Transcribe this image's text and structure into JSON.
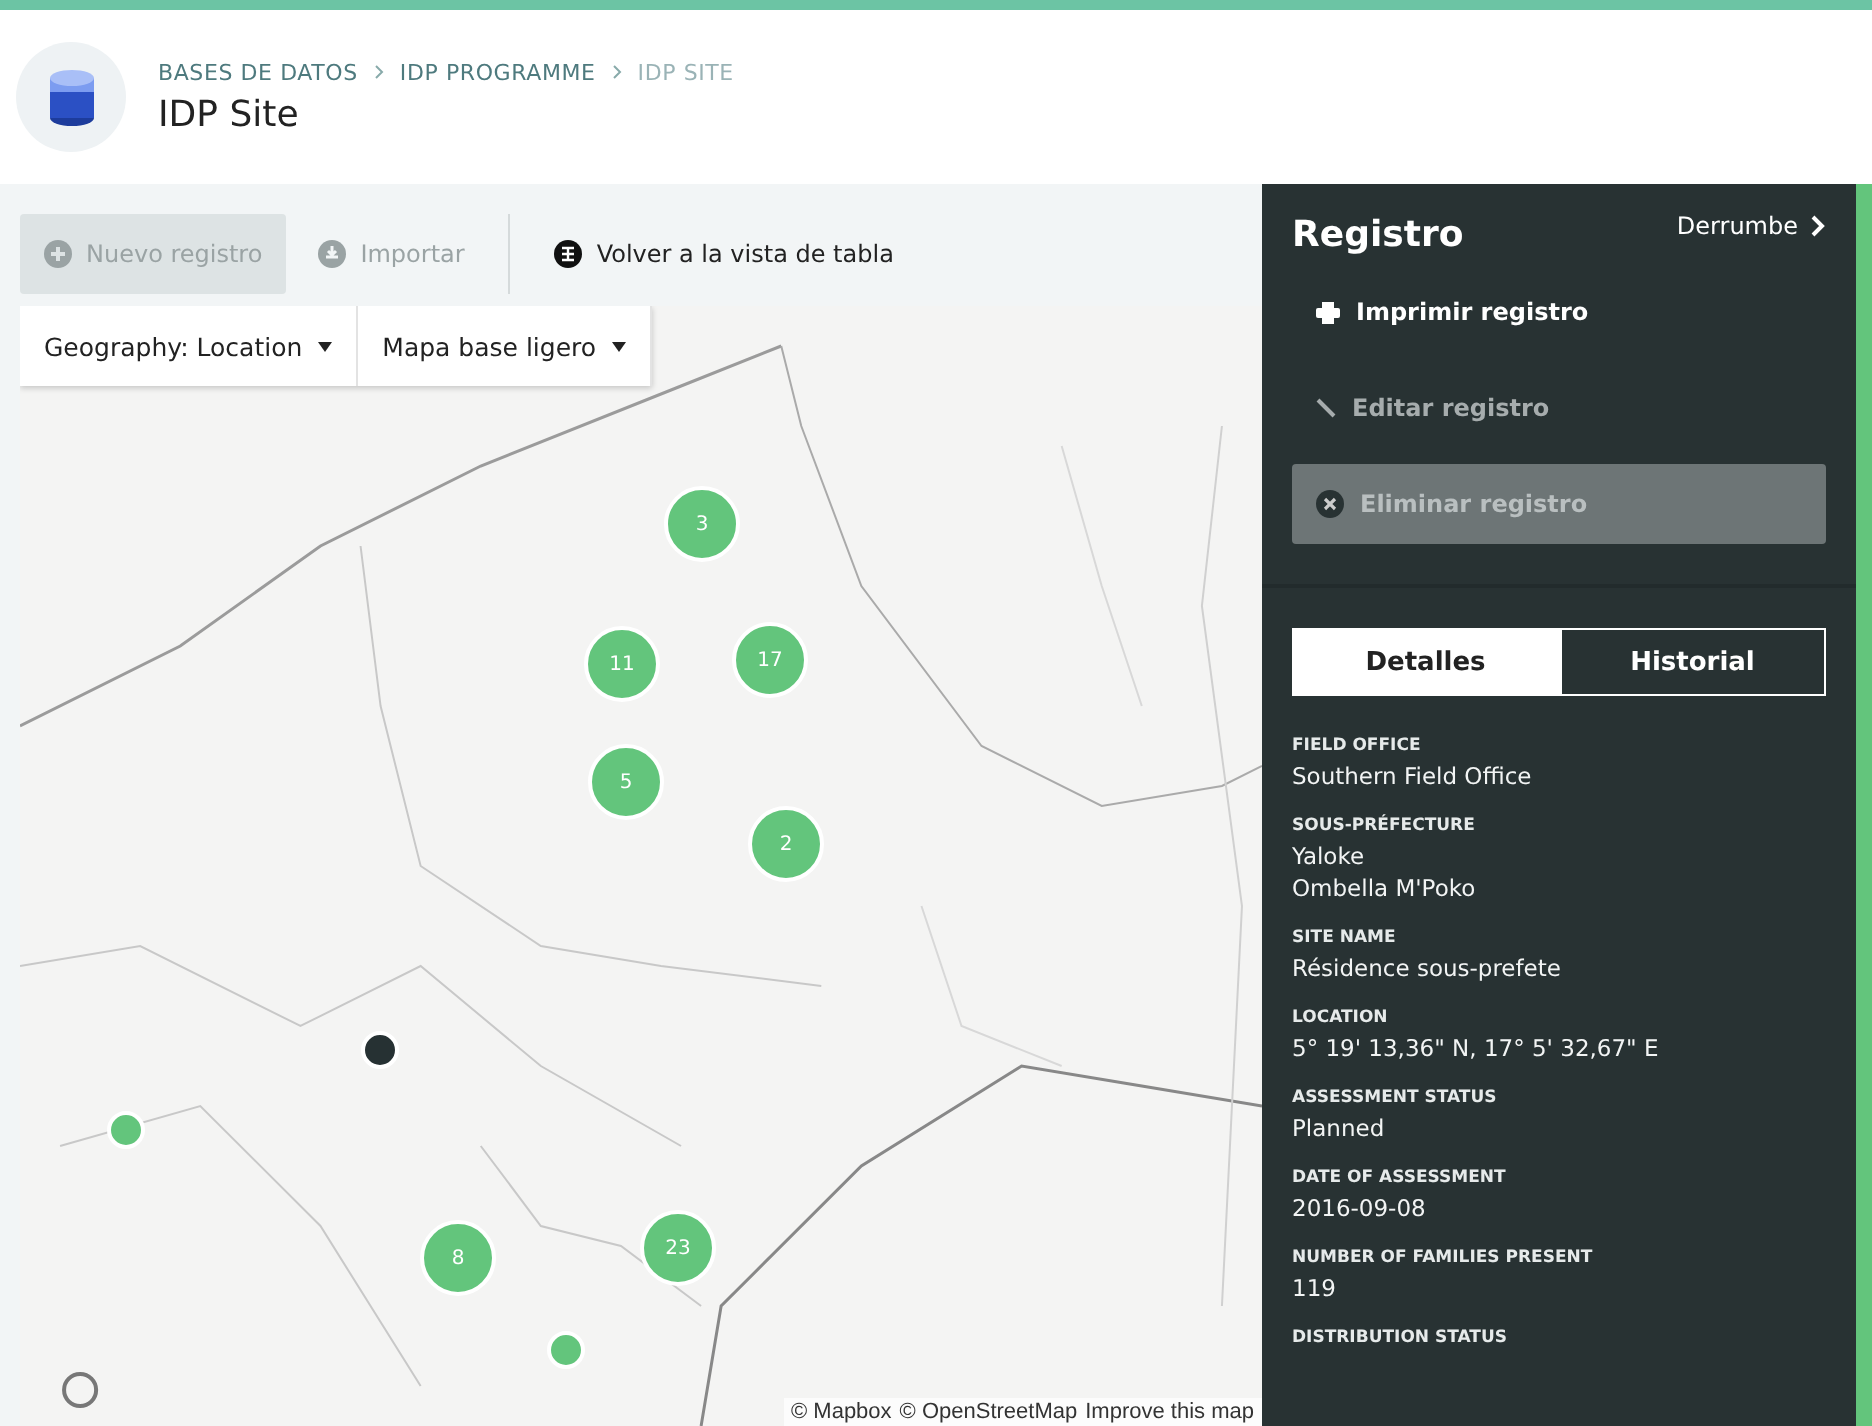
{
  "breadcrumb": [
    "BASES DE DATOS",
    "IDP PROGRAMME",
    "IDP SITE"
  ],
  "title": "IDP Site",
  "toolbar": [
    {
      "label": "Nuevo registro",
      "kind": "add",
      "disabled": true
    },
    {
      "label": "Importar",
      "kind": "import",
      "disabled": true
    },
    {
      "label": "Volver a la vista de tabla",
      "kind": "table",
      "disabled": false
    }
  ],
  "map_controls": [
    "Geography: Location",
    "Mapa base ligero"
  ],
  "map": {
    "markers": [
      {
        "label": "3",
        "kind": "cluster",
        "selected": false
      },
      {
        "label": "11",
        "kind": "cluster",
        "selected": false
      },
      {
        "label": "17",
        "kind": "cluster",
        "selected": false
      },
      {
        "label": "5",
        "kind": "cluster",
        "selected": false
      },
      {
        "label": "2",
        "kind": "cluster",
        "selected": false
      },
      {
        "label": "8",
        "kind": "cluster",
        "selected": false
      },
      {
        "label": "23",
        "kind": "cluster",
        "selected": false
      },
      {
        "kind": "point",
        "selected": false
      },
      {
        "kind": "point",
        "selected": false
      },
      {
        "kind": "point",
        "selected": true
      }
    ],
    "attribution": [
      "© Mapbox",
      "© OpenStreetMap",
      "Improve this map"
    ]
  },
  "panel": {
    "title": "Registro",
    "collapse": "Derrumbe",
    "actions": [
      {
        "label": "Imprimir registro",
        "kind": "print",
        "disabled": false
      },
      {
        "label": "Editar registro",
        "kind": "edit",
        "disabled": true
      },
      {
        "label": "Eliminar registro",
        "kind": "delete",
        "disabled": true
      }
    ],
    "tabs": [
      {
        "label": "Detalles",
        "selected": true
      },
      {
        "label": "Historial",
        "selected": false
      }
    ],
    "fields": [
      {
        "label": "FIELD OFFICE",
        "values": [
          "Southern Field Office"
        ]
      },
      {
        "label": "SOUS-PRÉFECTURE",
        "values": [
          "Yaloke",
          "Ombella M'Poko"
        ]
      },
      {
        "label": "SITE NAME",
        "values": [
          "Résidence sous-prefete"
        ]
      },
      {
        "label": "LOCATION",
        "values": [
          "5° 19' 13,36\" N, 17° 5' 32,67\" E"
        ]
      },
      {
        "label": "ASSESSMENT STATUS",
        "values": [
          "Planned"
        ]
      },
      {
        "label": "DATE OF ASSESSMENT",
        "values": [
          "2016-09-08"
        ]
      },
      {
        "label": "NUMBER OF FAMILIES PRESENT",
        "values": [
          "119"
        ]
      },
      {
        "label": "DISTRIBUTION STATUS"
      }
    ]
  }
}
